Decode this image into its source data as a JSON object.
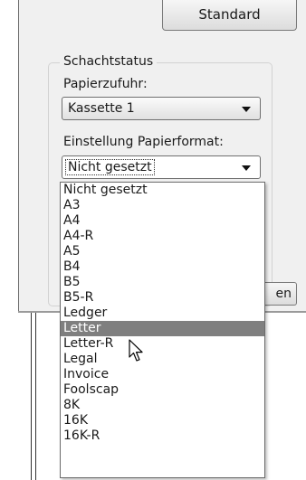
{
  "dialog": {
    "standard_button": "Standard",
    "partial_button": "en"
  },
  "tray_status": {
    "group_title": "Schachtstatus",
    "paper_feed_label": "Papierzufuhr:",
    "paper_feed_value": "Kassette 1",
    "paper_format_label": "Einstellung Papierformat:",
    "paper_format_value": "Nicht gesetzt"
  },
  "dropdown": {
    "options": [
      "Nicht gesetzt",
      "A3",
      "A4",
      "A4-R",
      "A5",
      "B4",
      "B5",
      "B5-R",
      "Ledger",
      "Letter",
      "Letter-R",
      "Legal",
      "Invoice",
      "Foolscap",
      "8K",
      "16K",
      "16K-R"
    ],
    "highlighted": "Letter"
  },
  "colors": {
    "highlight": "#7f7f7f",
    "dialog_background": "#f0f0f0"
  },
  "icons": {
    "combo_arrow": "chevron-down-icon",
    "pointer": "mouse-pointer-icon"
  }
}
